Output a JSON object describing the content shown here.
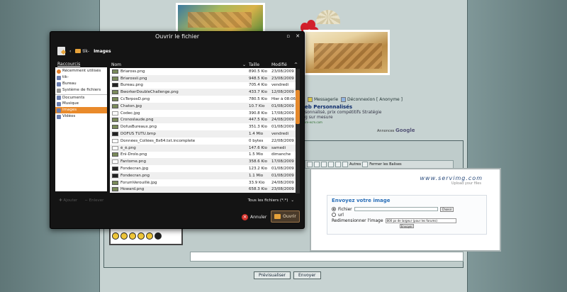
{
  "background": {
    "links": {
      "messagerie": "Messagerie",
      "logout": "Déconnexion [ Anonyme ]"
    },
    "ad": {
      "title": "eb Personnalisés",
      "line1": "sonnalisé, prix compétitifs Stratégie",
      "line2": "g sur mesure",
      "url": "ire-ecm.com"
    },
    "google": {
      "prefix": "Annonces",
      "brand": "Google"
    },
    "toolbar": {
      "autres": "Autres",
      "close_tags": "Fermer les Balises"
    },
    "buttons": {
      "preview": "Prévisualiser",
      "send": "Envoyer"
    }
  },
  "servimg": {
    "logo": "www.servimg.com",
    "tagline": "Upload your files",
    "title": "Envoyez votre image",
    "options": {
      "file": "Fichier",
      "url": "url"
    },
    "browse": "Choisir",
    "resize_label": "Redimensionner l'image",
    "resize_value": "800 px de largeur (pour les forums)",
    "send": "Envoyer"
  },
  "dialog": {
    "title": "Ouvrir le fichier",
    "path": [
      "tik-",
      "Images"
    ],
    "places_header": "Raccourcis",
    "places": [
      {
        "label": "Récemment utilisés",
        "icon": "recent-icon",
        "sel": false,
        "sep": false
      },
      {
        "label": "tik-",
        "icon": "home-folder-icon",
        "sel": false,
        "sep": false
      },
      {
        "label": "Bureau",
        "icon": "desktop-icon",
        "sel": false,
        "sep": false
      },
      {
        "label": "Système de fichiers",
        "icon": "drive-icon",
        "sel": false,
        "sep": false
      },
      {
        "label": "Documents",
        "icon": "folder-icon",
        "sel": false,
        "sep": true
      },
      {
        "label": "Musique",
        "icon": "folder-icon",
        "sel": false,
        "sep": false
      },
      {
        "label": "Images",
        "icon": "folder-icon",
        "sel": true,
        "sep": false
      },
      {
        "label": "Vidéos",
        "icon": "folder-icon",
        "sel": false,
        "sep": false
      }
    ],
    "columns": {
      "name": "Nom",
      "size": "Taille",
      "modified": "Modifié"
    },
    "files": [
      {
        "name": "Briaross.png",
        "size": "890.5 Kio",
        "date": "23/08/2009",
        "icon": "image"
      },
      {
        "name": "Briarossii.png",
        "size": "948.5 Kio",
        "date": "23/08/2009",
        "icon": "image"
      },
      {
        "name": "Bureau.png",
        "size": "705.4 Kio",
        "date": "vendredi",
        "icon": "dark"
      },
      {
        "name": "BworkerDoubleChallenge.png",
        "size": "433.7 Kio",
        "date": "12/08/2009",
        "icon": "image"
      },
      {
        "name": "CcTerposD.png",
        "size": "780.5 Kio",
        "date": "Hier à 08:06",
        "icon": "image"
      },
      {
        "name": "Chaton.jpg",
        "size": "10.7 Kio",
        "date": "01/08/2009",
        "icon": "image"
      },
      {
        "name": "Codec.jpg",
        "size": "390.8 Kio",
        "date": "17/08/2009",
        "icon": "doc"
      },
      {
        "name": "Cronoslaude.png",
        "size": "447.5 Kio",
        "date": "24/08/2009",
        "icon": "image"
      },
      {
        "name": "DofusBureaux.png",
        "size": "351.3 Kio",
        "date": "01/08/2009",
        "icon": "image"
      },
      {
        "name": "DOFUS TUTU.bmp",
        "size": "1.4 Mio",
        "date": "vendredi",
        "icon": "dark"
      },
      {
        "name": "Données_Collées_8x64.txt.incomplete",
        "size": "0 bytes",
        "date": "22/08/2009",
        "icon": "doc"
      },
      {
        "name": "é_è.png",
        "size": "147.6 Kio",
        "date": "samedi",
        "icon": "doc"
      },
      {
        "name": "Eni-Drolo.png",
        "size": "1.5 Mio",
        "date": "dimanche",
        "icon": "image"
      },
      {
        "name": "Fantome.png",
        "size": "358.6 Kio",
        "date": "17/08/2009",
        "icon": "doc"
      },
      {
        "name": "Fondecran.jpg",
        "size": "123.2 Kio",
        "date": "01/08/2009",
        "icon": "dark"
      },
      {
        "name": "Fondecran.png",
        "size": "1.1 Mio",
        "date": "01/08/2009",
        "icon": "dark"
      },
      {
        "name": "ForumVerouillé.jpg",
        "size": "33.9 Kio",
        "date": "24/08/2009",
        "icon": "image"
      },
      {
        "name": "Howard.png",
        "size": "658.3 Kio",
        "date": "23/08/2009",
        "icon": "image"
      }
    ],
    "add_label": "Ajouter",
    "remove_label": "Enlever",
    "filter": "Tous les fichiers (*.*)",
    "cancel": "Annuler",
    "open": "Ouvrir"
  }
}
